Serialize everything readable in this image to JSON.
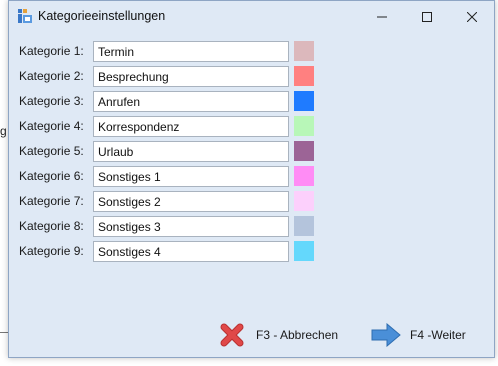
{
  "background": {
    "stray_char": "g"
  },
  "window": {
    "title": "Kategorieeinstellungen",
    "icon": "settings-app-icon",
    "controls": [
      "minimize-icon",
      "maximize-icon",
      "close-icon"
    ]
  },
  "categories": [
    {
      "label": "Kategorie 1:",
      "value": "Termin",
      "color": "#dcb8bc"
    },
    {
      "label": "Kategorie 2:",
      "value": "Besprechung",
      "color": "#ff8080"
    },
    {
      "label": "Kategorie 3:",
      "value": "Anrufen",
      "color": "#1f7bff"
    },
    {
      "label": "Kategorie 4:",
      "value": "Korrespondenz",
      "color": "#b8f7b8"
    },
    {
      "label": "Kategorie 5:",
      "value": "Urlaub",
      "color": "#9c6496"
    },
    {
      "label": "Kategorie 6:",
      "value": "Sonstiges 1",
      "color": "#ff8cf5"
    },
    {
      "label": "Kategorie 7:",
      "value": "Sonstiges 2",
      "color": "#fcd0fc"
    },
    {
      "label": "Kategorie 8:",
      "value": "Sonstiges 3",
      "color": "#b4c4dc"
    },
    {
      "label": "Kategorie 9:",
      "value": "Sonstiges 4",
      "color": "#64d8fc"
    }
  ],
  "footer": {
    "cancel_label": "F3 - Abbrechen",
    "next_label": "F4 -Weiter",
    "cancel_color": "#e04848",
    "next_color": "#4a8fd8"
  }
}
